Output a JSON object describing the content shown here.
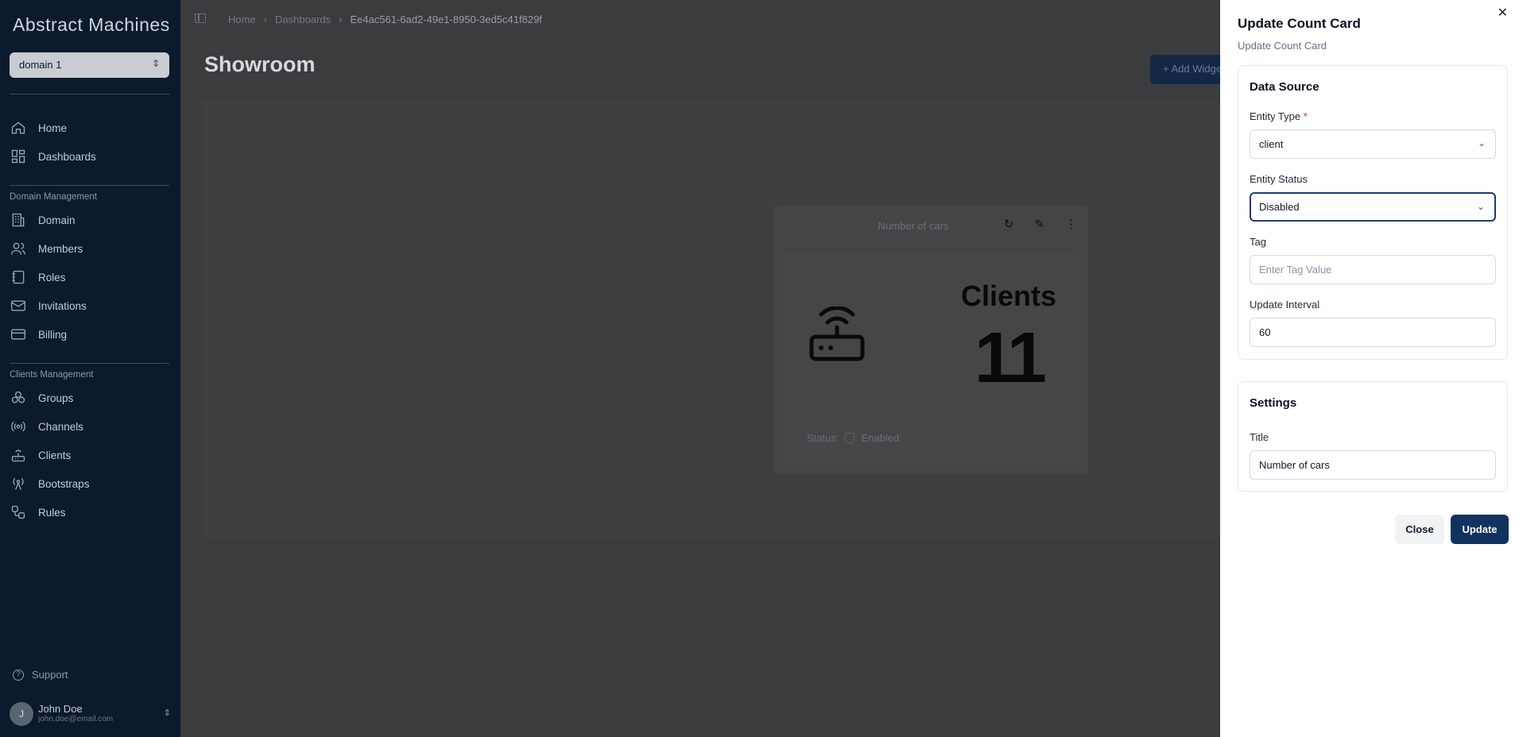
{
  "sidebar": {
    "logo": "Abstract Machines",
    "domain_select": "domain 1",
    "nav_main": [
      {
        "label": "Home",
        "icon": "home-icon"
      },
      {
        "label": "Dashboards",
        "icon": "dashboards-icon"
      }
    ],
    "section_domain": "Domain Management",
    "nav_domain": [
      {
        "label": "Domain",
        "icon": "building-icon"
      },
      {
        "label": "Members",
        "icon": "users-icon"
      },
      {
        "label": "Roles",
        "icon": "notebook-icon"
      },
      {
        "label": "Invitations",
        "icon": "mail-icon"
      },
      {
        "label": "Billing",
        "icon": "card-icon"
      }
    ],
    "section_clients": "Clients Management",
    "nav_clients": [
      {
        "label": "Groups",
        "icon": "groups-icon"
      },
      {
        "label": "Channels",
        "icon": "radio-icon"
      },
      {
        "label": "Clients",
        "icon": "router-icon"
      },
      {
        "label": "Bootstraps",
        "icon": "antenna-icon"
      },
      {
        "label": "Rules",
        "icon": "workflow-icon"
      }
    ],
    "support": "Support",
    "user": {
      "initial": "J",
      "name": "John Doe",
      "email": "john.doe@email.com"
    }
  },
  "header": {
    "breadcrumb": [
      "Home",
      "Dashboards",
      "Ee4ac561-6ad2-49e1-8950-3ed5c41f829f"
    ],
    "title": "Showroom",
    "add_widget": "+ Add Widget"
  },
  "card": {
    "title": "Number of cars",
    "label": "Clients",
    "value": "11",
    "status_label": "Status:",
    "status_value": "Enabled"
  },
  "drawer": {
    "title": "Update Count Card",
    "subtitle": "Update Count Card",
    "data_source": {
      "heading": "Data Source",
      "entity_type_label": "Entity Type",
      "entity_type_value": "client",
      "entity_status_label": "Entity Status",
      "entity_status_value": "Disabled",
      "tag_label": "Tag",
      "tag_placeholder": "Enter Tag Value",
      "update_interval_label": "Update Interval",
      "update_interval_value": "60"
    },
    "settings": {
      "heading": "Settings",
      "title_label": "Title",
      "title_value": "Number of cars"
    },
    "close_label": "Close",
    "update_label": "Update"
  },
  "colors": {
    "sidebar_bg": "#0b1a2c",
    "primary": "#11325f",
    "focus_border": "#1f3d73"
  }
}
